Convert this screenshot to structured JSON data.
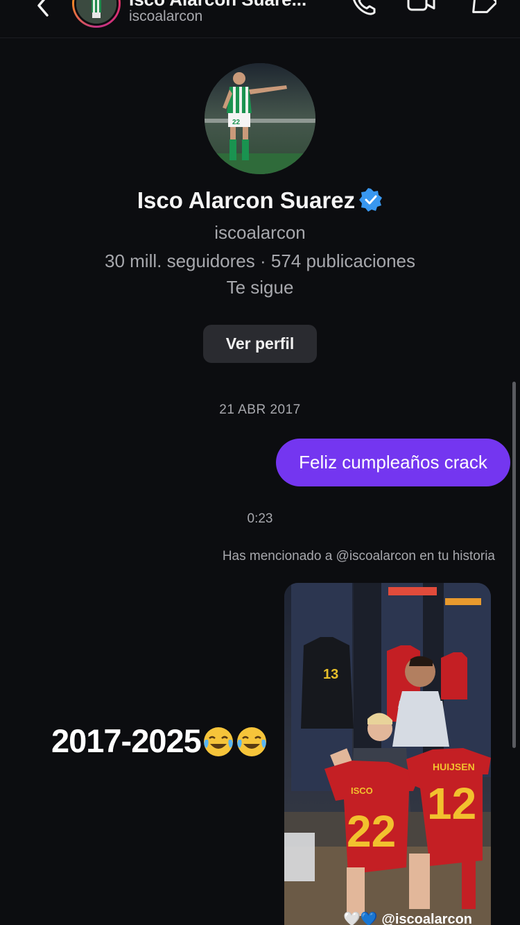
{
  "header": {
    "contact_name": "Isco Alarcon Suare...",
    "username": "iscoalarcon",
    "icons": [
      "back-chevron-icon",
      "phone-icon",
      "video-camera-icon",
      "tag-icon"
    ]
  },
  "profile": {
    "name": "Isco Alarcon Suarez",
    "verified": true,
    "username": "iscoalarcon",
    "stats": "30 mill. seguidores · 574 publicaciones",
    "follows_you": "Te sigue",
    "view_profile_label": "Ver perfil"
  },
  "conversation": {
    "date_separator": "21 ABR 2017",
    "outgoing_message": "Feliz cumpleaños crack",
    "time": "0:23",
    "mention_note": "Has mencionado a @iscoalarcon en tu historia",
    "story": {
      "caption": "2017-2025",
      "caption_emoji": "face-with-tears-of-joy-icon",
      "jersey_left_name": "ISCO",
      "jersey_left_number": "22",
      "jersey_right_name": "HUIJSEN",
      "jersey_right_number": "12",
      "locker_jersey_number": "13",
      "footer": "🤍💙 @iscoalarcon"
    }
  },
  "colors": {
    "background": "#0c0d10",
    "bubble": "#7436f0",
    "button": "#2a2b30",
    "secondary_text": "#a7a8ad",
    "verified": "#3897f0"
  }
}
